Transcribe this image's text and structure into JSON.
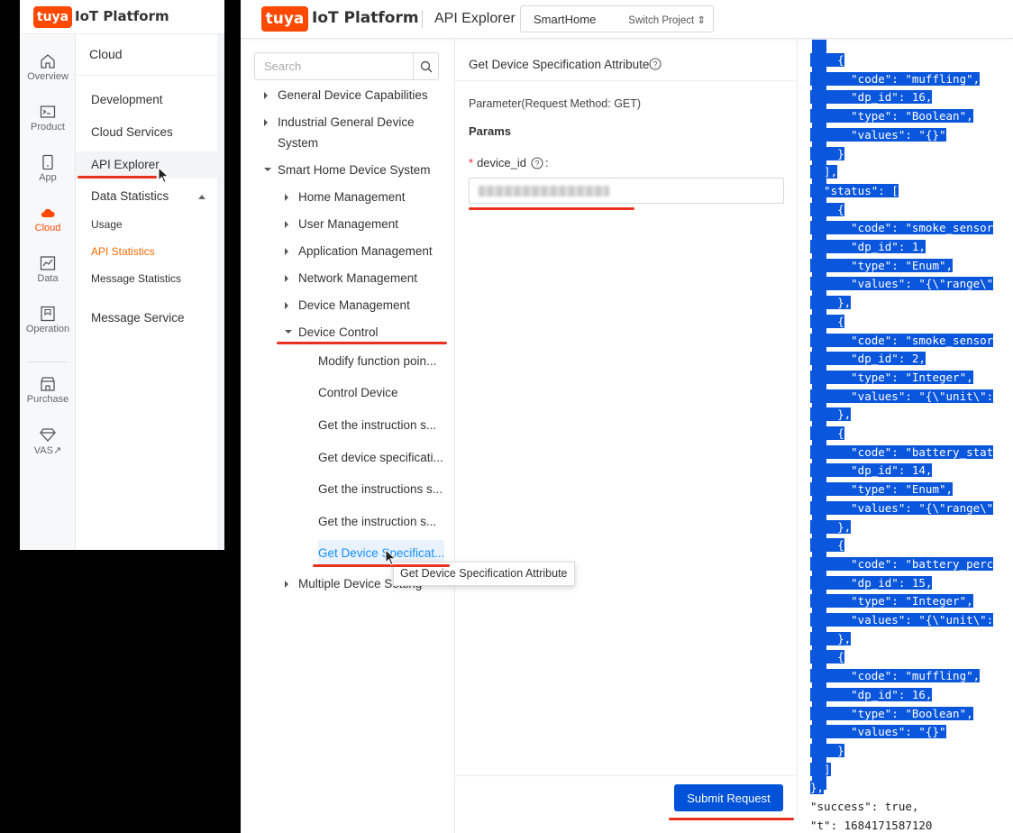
{
  "left_panel": {
    "logo_badge": "tuya",
    "logo_text": "IoT Platform",
    "rail": [
      {
        "label": "Overview",
        "icon": "home-icon"
      },
      {
        "label": "Product",
        "icon": "terminal-icon"
      },
      {
        "label": "App",
        "icon": "mobile-icon"
      },
      {
        "label": "Cloud",
        "icon": "cloud-icon"
      },
      {
        "label": "Data",
        "icon": "chart-icon"
      },
      {
        "label": "Operation",
        "icon": "bookmark-icon"
      },
      {
        "label": "Purchase",
        "icon": "store-icon"
      },
      {
        "label": "VAS",
        "icon": "diamond-icon"
      }
    ],
    "submenu": {
      "title": "Cloud",
      "items": [
        "Development",
        "Cloud Services",
        "API Explorer",
        "Data Statistics",
        "Usage",
        "API Statistics",
        "Message Statistics",
        "Message Service"
      ]
    }
  },
  "topbar": {
    "logo_badge": "tuya",
    "logo_text": "IoT Platform",
    "app_name": "API Explorer",
    "project": "SmartHome",
    "switch_label": "Switch Project"
  },
  "tree": {
    "search_placeholder": "Search",
    "nodes": {
      "general": "General Device Capabilities",
      "industrial_1": "Industrial General Device",
      "industrial_2": "System",
      "smart_home": "Smart Home Device System",
      "home": "Home Management",
      "user": "User Management",
      "application": "Application Management",
      "network": "Network Management",
      "device_mgmt": "Device Management",
      "device_control": "Device Control",
      "multiple": "Multiple Device Setting"
    },
    "leaves": [
      "Modify function poin...",
      "Control Device",
      "Get the instruction s...",
      "Get device specificati...",
      "Get the instructions s...",
      "Get the instruction s...",
      "Get Device Specificat..."
    ],
    "tooltip": "Get Device Specification Attribute"
  },
  "detail": {
    "title": "Get Device Specification Attribute",
    "method": "Parameter(Request Method: GET)",
    "params_label": "Params",
    "required_mark": "*",
    "field_label": "device_id",
    "field_colon": ":",
    "submit": "Submit Request"
  },
  "json": {
    "lines": [
      "    {",
      "      \"code\": \"muffling\",",
      "      \"dp_id\": 16,",
      "      \"type\": \"Boolean\",",
      "      \"values\": \"{}\"",
      "    }",
      "  ],",
      "  \"status\": [",
      "    {",
      "      \"code\": \"smoke_sensor",
      "      \"dp_id\": 1,",
      "      \"type\": \"Enum\",",
      "      \"values\": \"{\\\"range\\\"",
      "    },",
      "    {",
      "      \"code\": \"smoke_sensor",
      "      \"dp_id\": 2,",
      "      \"type\": \"Integer\",",
      "      \"values\": \"{\\\"unit\\\":",
      "    },",
      "    {",
      "      \"code\": \"battery_stat",
      "      \"dp_id\": 14,",
      "      \"type\": \"Enum\",",
      "      \"values\": \"{\\\"range\\\"",
      "    },",
      "    {",
      "      \"code\": \"battery_perc",
      "      \"dp_id\": 15,",
      "      \"type\": \"Integer\",",
      "      \"values\": \"{\\\"unit\\\":",
      "    },",
      "    {",
      "      \"code\": \"muffling\",",
      "      \"dp_id\": 16,",
      "      \"type\": \"Boolean\",",
      "      \"values\": \"{}\"",
      "    }",
      "  ]",
      "},",
      "\"success\": true,",
      "\"t\": 1684171587120"
    ]
  },
  "colors": {
    "brand": "#ff4800",
    "primary": "#0052d9",
    "selection": "#0a56dc",
    "annotation": "#e8321f"
  }
}
